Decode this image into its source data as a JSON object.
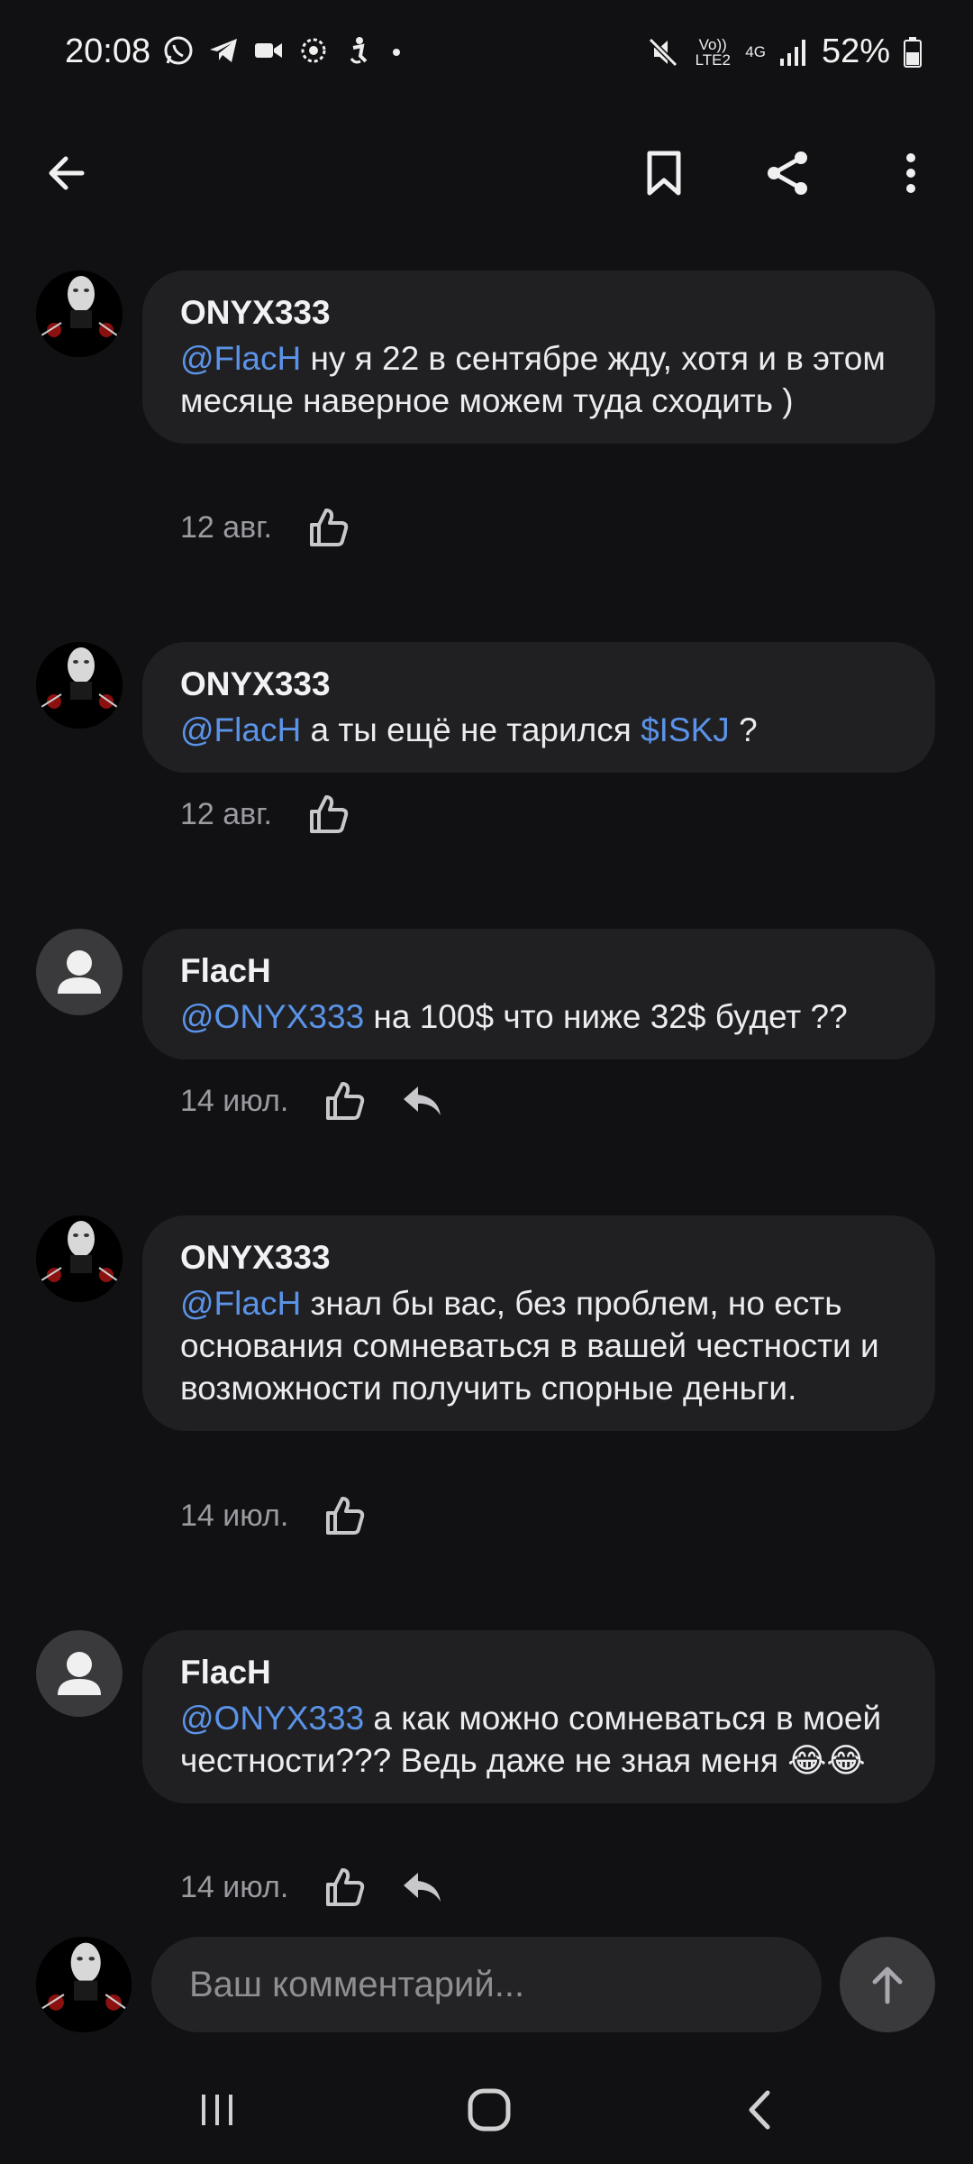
{
  "status": {
    "time": "20:08",
    "volte": "Vo)) LTE2",
    "net": "4G",
    "battery": "52%"
  },
  "composer": {
    "placeholder": "Ваш комментарий..."
  },
  "comments": [
    {
      "author": "ONYX333",
      "mention": "@FlacH",
      "text": " ну я 22 в сентябре жду, хотя и в этом месяце наверное можем туда сходить )",
      "date": "12 авг."
    },
    {
      "author": "ONYX333",
      "mention": "@FlacH",
      "text_a": " а ты ещё не тарился ",
      "ticker": "$ISKJ",
      "text_b": " ?",
      "date": "12 авг."
    },
    {
      "author": "FlacH",
      "mention": "@ONYX333",
      "text": " на 100$ что ниже 32$ будет ??",
      "date": "14 июл."
    },
    {
      "author": "ONYX333",
      "mention": "@FlacH",
      "text": " знал бы вас, без проблем, но есть основания сомневаться в вашей честности и возможности получить спорные деньги.",
      "date": "14 июл."
    },
    {
      "author": "FlacH",
      "mention": "@ONYX333",
      "text": " а как можно сомневаться в моей честности??? Ведь даже не зная меня 😂😂",
      "date": "14 июл."
    }
  ]
}
